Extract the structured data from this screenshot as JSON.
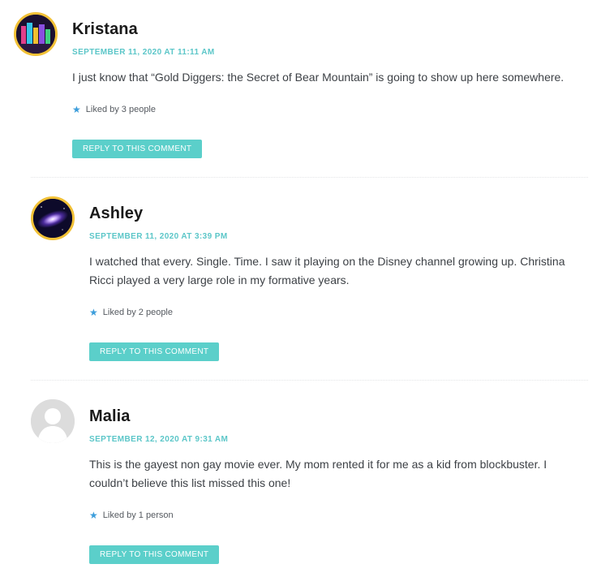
{
  "comments": [
    {
      "author": "Kristana",
      "date": "SEPTEMBER 11, 2020 AT 11:11 AM",
      "text": "I just know that “Gold Diggers: the Secret of Bear Mountain” is going to show up here somewhere.",
      "likes": "Liked by 3 people",
      "reply": "REPLY TO THIS COMMENT"
    },
    {
      "author": "Ashley",
      "date": "SEPTEMBER 11, 2020 AT 3:39 PM",
      "text": "I watched that every. Single. Time. I saw it playing on the Disney channel growing up. Christina Ricci played a very large role in my formative years.",
      "likes": "Liked by 2 people",
      "reply": "REPLY TO THIS COMMENT"
    },
    {
      "author": "Malia",
      "date": "SEPTEMBER 12, 2020 AT 9:31 AM",
      "text": "This is the gayest non gay movie ever. My mom rented it for me as a kid from blockbuster. I couldn’t believe this list missed this one!",
      "likes": "Liked by 1 person",
      "reply": "REPLY TO THIS COMMENT"
    }
  ],
  "colors": {
    "accent": "#5bc6c8",
    "button": "#5bcfca",
    "star": "#3c9ddb",
    "avatar_ring": "#f2c136"
  },
  "icons": {
    "like": "star-icon",
    "avatar_default": "default-user-icon"
  }
}
